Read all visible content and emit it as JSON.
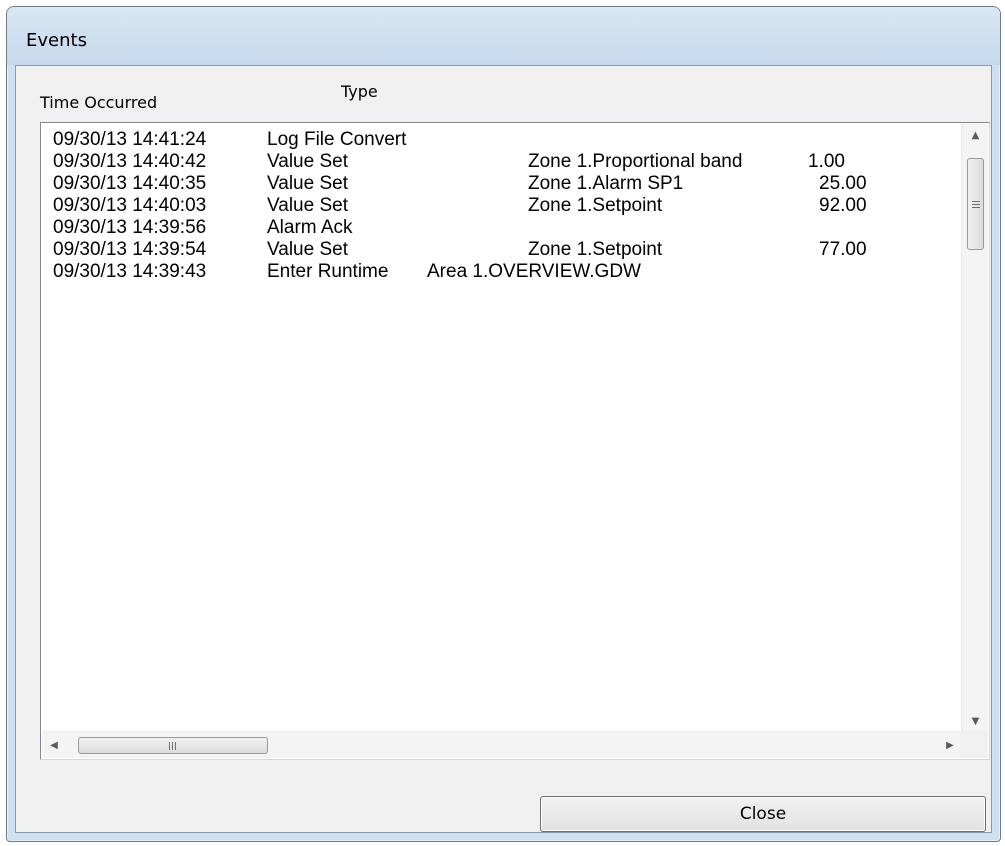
{
  "window": {
    "title": "Events"
  },
  "columns": {
    "time_occurred": "Time Occurred",
    "type": "Type"
  },
  "events": [
    {
      "time": "09/30/13 14:41:24",
      "type": "Log File Convert",
      "tag": "",
      "value": "",
      "area": ""
    },
    {
      "time": "09/30/13 14:40:42",
      "type": "Value Set",
      "tag": "Zone 1.Proportional band",
      "value": "1.00",
      "area": ""
    },
    {
      "time": "09/30/13 14:40:35",
      "type": "Value Set",
      "tag": "Zone 1.Alarm SP1",
      "value": "25.00",
      "area": ""
    },
    {
      "time": "09/30/13 14:40:03",
      "type": "Value Set",
      "tag": "Zone 1.Setpoint",
      "value": "92.00",
      "area": ""
    },
    {
      "time": "09/30/13 14:39:56",
      "type": "Alarm Ack",
      "tag": "",
      "value": "",
      "area": ""
    },
    {
      "time": "09/30/13 14:39:54",
      "type": "Value Set",
      "tag": "Zone 1.Setpoint",
      "value": "77.00",
      "area": ""
    },
    {
      "time": "09/30/13 14:39:43",
      "type": "Enter Runtime",
      "tag": "",
      "value": "",
      "area": "Area 1.OVERVIEW.GDW"
    }
  ],
  "scrollbars": {
    "up_arrow_icon": "triangle-up",
    "down_arrow_icon": "triangle-down",
    "left_arrow_icon": "triangle-left",
    "right_arrow_icon": "triangle-right"
  },
  "buttons": {
    "close_label": "Close"
  }
}
